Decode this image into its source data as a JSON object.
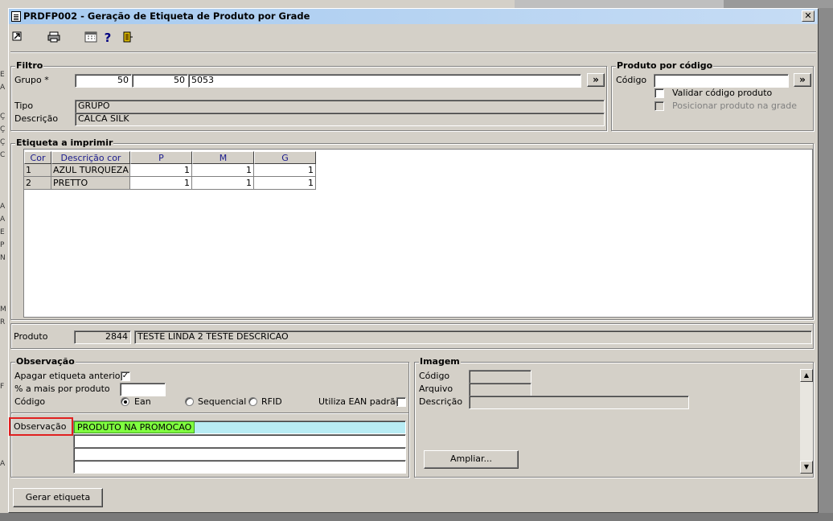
{
  "window": {
    "title": "PRDFP002 - Geração de Etiqueta de Produto por Grade",
    "close_glyph": "✕"
  },
  "toolbar": {
    "icons": [
      "back-icon",
      "print-icon",
      "calendar-icon",
      "help-icon",
      "exit-door-icon"
    ],
    "help_glyph": "?"
  },
  "filtro": {
    "title": "Filtro",
    "grupo_label": "Grupo *",
    "grupo_values": [
      "50",
      "50",
      "5053"
    ],
    "grupo_btn": "»",
    "tipo_label": "Tipo",
    "tipo_value": "GRUPO",
    "descricao_label": "Descrição",
    "descricao_value": "CALCA SILK"
  },
  "produto_codigo": {
    "title": "Produto por código",
    "codigo_label": "Código",
    "codigo_value": "",
    "codigo_btn": "»",
    "validar_label": "Validar código produto",
    "validar_checked": false,
    "posicionar_label": "Posicionar produto na grade",
    "posicionar_checked": false
  },
  "etiqueta": {
    "title": "Etiqueta a imprimir",
    "columns": [
      "Cor",
      "Descrição cor",
      "P",
      "M",
      "G"
    ],
    "rows": [
      {
        "cor": "1",
        "descricao": "AZUL TURQUEZA",
        "p": "1",
        "m": "1",
        "g": "1"
      },
      {
        "cor": "2",
        "descricao": "PRETTO",
        "p": "1",
        "m": "1",
        "g": "1"
      }
    ]
  },
  "produto": {
    "label": "Produto",
    "code": "2844",
    "description": "TESTE LINDA 2 TESTE DESCRICAO"
  },
  "observacao": {
    "title": "Observação",
    "apagar_label": "Apagar etiqueta anterior",
    "apagar_checked": "✓",
    "percent_label": "% a mais por produto",
    "percent_value": "",
    "codigo_label": "Código",
    "options": [
      "Ean",
      "Sequencial",
      "RFID"
    ],
    "selected_option": "Ean",
    "utiliza_ean_label": "Utiliza EAN padrão",
    "obs_label": "Observação",
    "obs_lines": [
      "PRODUTO NA PROMOCAO",
      "",
      "",
      ""
    ]
  },
  "imagem": {
    "title": "Imagem",
    "codigo_label": "Código",
    "arquivo_label": "Arquivo",
    "descricao_label": "Descrição",
    "ampliar_btn": "Ampliar..."
  },
  "footer": {
    "gerar_btn": "Gerar etiqueta"
  },
  "colors": {
    "titlebar": "#a6caf0",
    "highlight_green": "#80ff40",
    "highlight_cyan": "#b8ecf4",
    "annotation_red": "#e02020",
    "header_text": "#1a1a8c"
  },
  "background_letters": [
    "E",
    "A",
    "Ç",
    "Ç",
    "Ç",
    "C",
    "A",
    "A",
    "E",
    "P",
    "N",
    "M",
    "R",
    "F",
    "A"
  ]
}
